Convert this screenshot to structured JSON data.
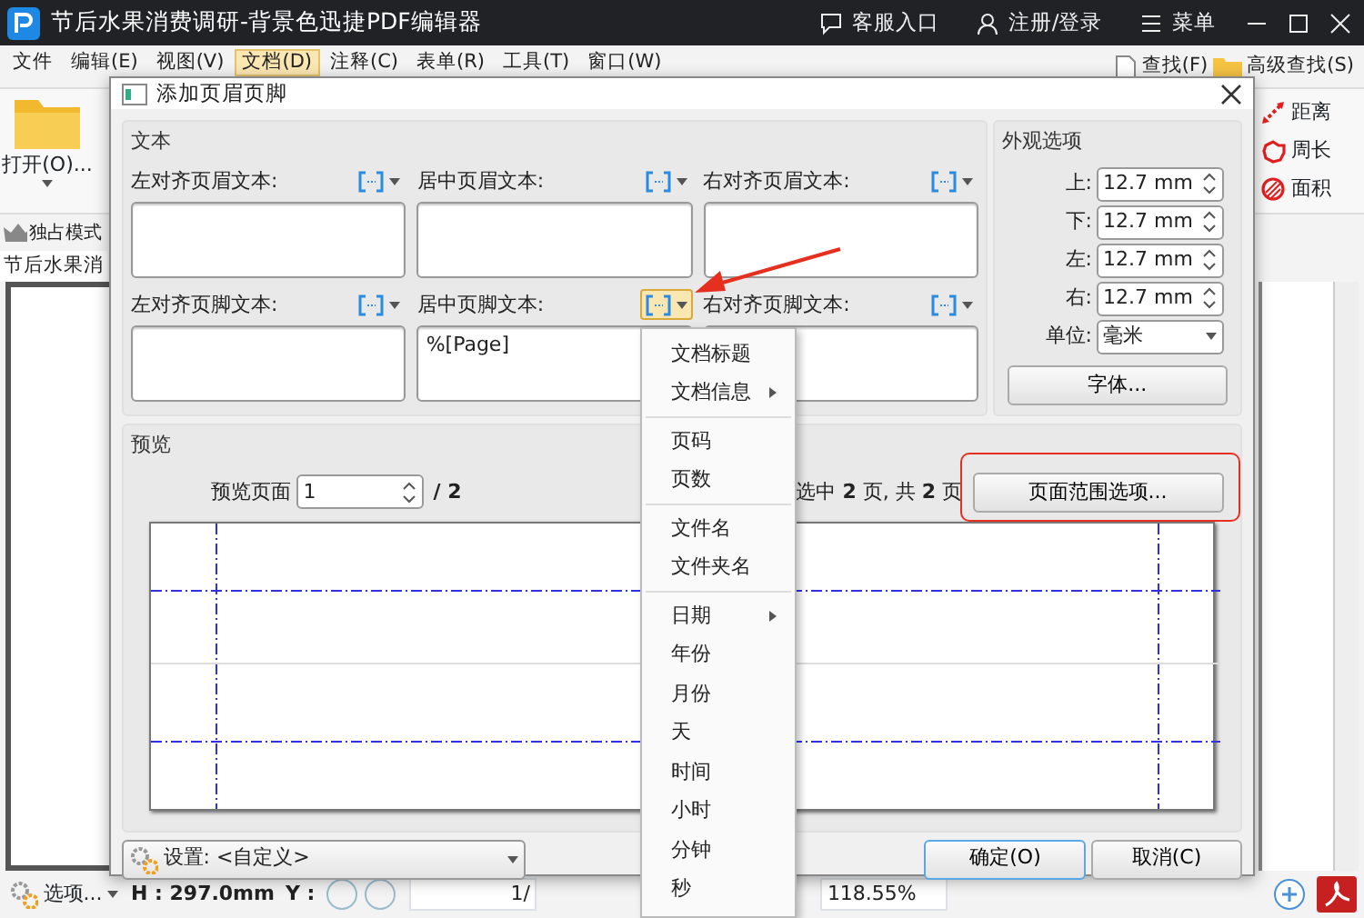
{
  "window": {
    "title": "节后水果消费调研-背景色迅捷PDF编辑器",
    "actions": [
      "客服入口",
      "注册/登录",
      "菜单"
    ]
  },
  "menu_bar": [
    {
      "label": "文件",
      "selected": false
    },
    {
      "label": "编辑(E)",
      "selected": false
    },
    {
      "label": "视图(V)",
      "selected": false
    },
    {
      "label": "文档(D)",
      "selected": true
    },
    {
      "label": "注释(C)",
      "selected": false
    },
    {
      "label": "表单(R)",
      "selected": false
    },
    {
      "label": "工具(T)",
      "selected": false
    },
    {
      "label": "窗口(W)",
      "selected": false
    }
  ],
  "search_tools": [
    "查找(F)",
    "高级查找(S)"
  ],
  "ribbon": {
    "open_label": "打开(O)...",
    "measure": [
      {
        "kind": "distance",
        "label": "距离"
      },
      {
        "kind": "perimeter",
        "label": "周长"
      },
      {
        "kind": "area",
        "label": "面积"
      }
    ]
  },
  "exclusive_mode": "独占模式",
  "document_tab": "节后水果消",
  "status_bar": {
    "options": "选项...",
    "height": "H : 297.0mm",
    "y": "Y :",
    "page": "1/",
    "zoom": "118.55%"
  },
  "dialog": {
    "title": "添加页眉页脚",
    "text_group": "文本",
    "fields": [
      {
        "label": "左对齐页眉文本:",
        "menu_open": false
      },
      {
        "label": "居中页眉文本:",
        "menu_open": false
      },
      {
        "label": "右对齐页眉文本:",
        "menu_open": false
      },
      {
        "label": "左对齐页脚文本:",
        "menu_open": false
      },
      {
        "label": "居中页脚文本:",
        "value": "%[Page]",
        "menu_open": true
      },
      {
        "label": "右对齐页脚文本:",
        "menu_open": false
      }
    ],
    "appearance": {
      "title": "外观选项",
      "margins": [
        {
          "label": "上:",
          "value": "12.7 mm"
        },
        {
          "label": "下:",
          "value": "12.7 mm"
        },
        {
          "label": "左:",
          "value": "12.7 mm"
        },
        {
          "label": "右:",
          "value": "12.7 mm"
        }
      ],
      "unit_label": "单位:",
      "unit": "毫米",
      "font_button": "字体..."
    },
    "preview": {
      "title": "预览",
      "page_label": "预览页面",
      "page": "1",
      "total": "/ 2",
      "range": "选中 **2** 页, 共 **2** 页",
      "range_button": "页面范围选项..."
    },
    "settings": "设置: <自定义>",
    "ok": "确定(O)",
    "cancel": "取消(C)"
  },
  "insert_menu": [
    {
      "label": "文档标题",
      "submenu": false,
      "separator_before": false
    },
    {
      "label": "文档信息",
      "submenu": true,
      "separator_before": false
    },
    {
      "label": "页码",
      "submenu": false,
      "separator_before": true
    },
    {
      "label": "页数",
      "submenu": false,
      "separator_before": false
    },
    {
      "label": "文件名",
      "submenu": false,
      "separator_before": true
    },
    {
      "label": "文件夹名",
      "submenu": false,
      "separator_before": false
    },
    {
      "label": "日期",
      "submenu": true,
      "separator_before": true
    },
    {
      "label": "年份",
      "submenu": false,
      "separator_before": false
    },
    {
      "label": "月份",
      "submenu": false,
      "separator_before": false
    },
    {
      "label": "天",
      "submenu": false,
      "separator_before": false
    },
    {
      "label": "时间",
      "submenu": false,
      "separator_before": false
    },
    {
      "label": "小时",
      "submenu": false,
      "separator_before": false
    },
    {
      "label": "分钟",
      "submenu": false,
      "separator_before": false
    },
    {
      "label": "秒",
      "submenu": false,
      "separator_before": false
    }
  ]
}
